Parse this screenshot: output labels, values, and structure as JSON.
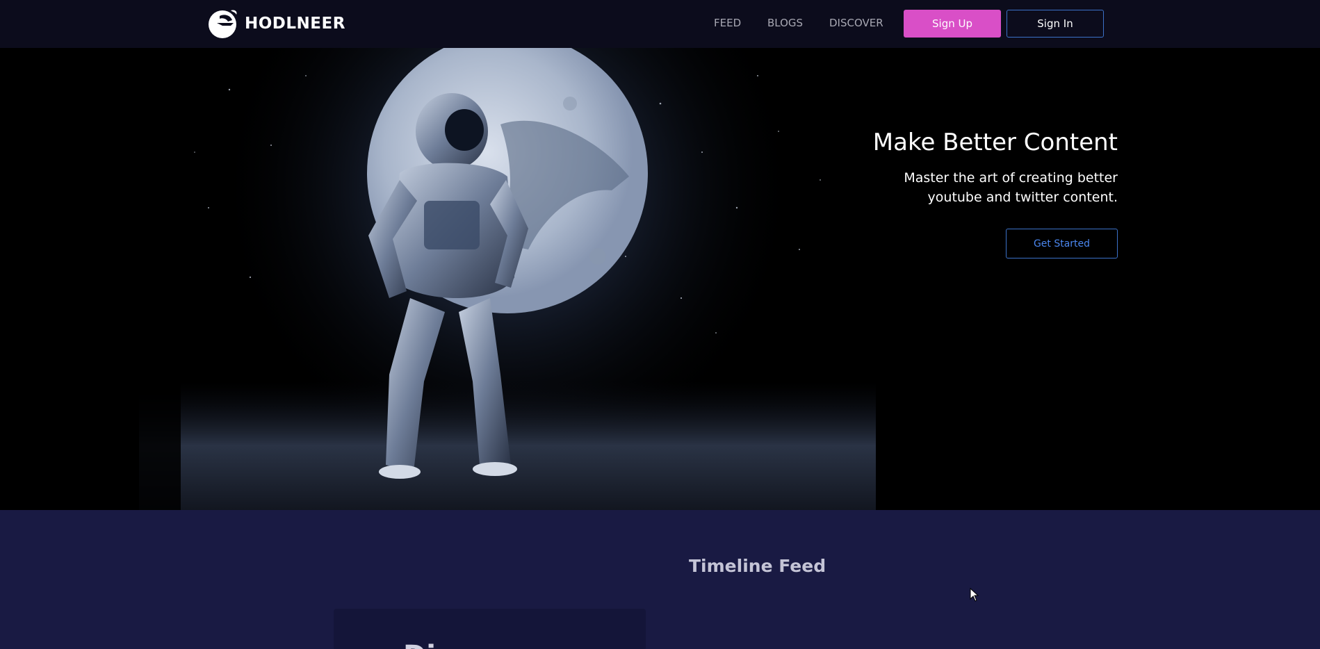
{
  "header": {
    "logo_text": "HODLNEER",
    "nav": {
      "feed": "FEED",
      "blogs": "BLOGS",
      "discover": "DISCOVER"
    },
    "signup_label": "Sign Up",
    "signin_label": "Sign In"
  },
  "hero": {
    "title": "Make Better Content",
    "subtitle_line1": "Master the art of creating better",
    "subtitle_line2": "youtube and twitter content.",
    "cta_label": "Get Started",
    "illustration": "astronaut-moon-illustration"
  },
  "timeline": {
    "title": "Timeline Feed",
    "card_heading_partial": "Di...."
  },
  "colors": {
    "header_bg": "#0c0c1c",
    "accent_pink": "#d94fc7",
    "accent_blue": "#3c72c9",
    "section_bg": "#191a43"
  }
}
